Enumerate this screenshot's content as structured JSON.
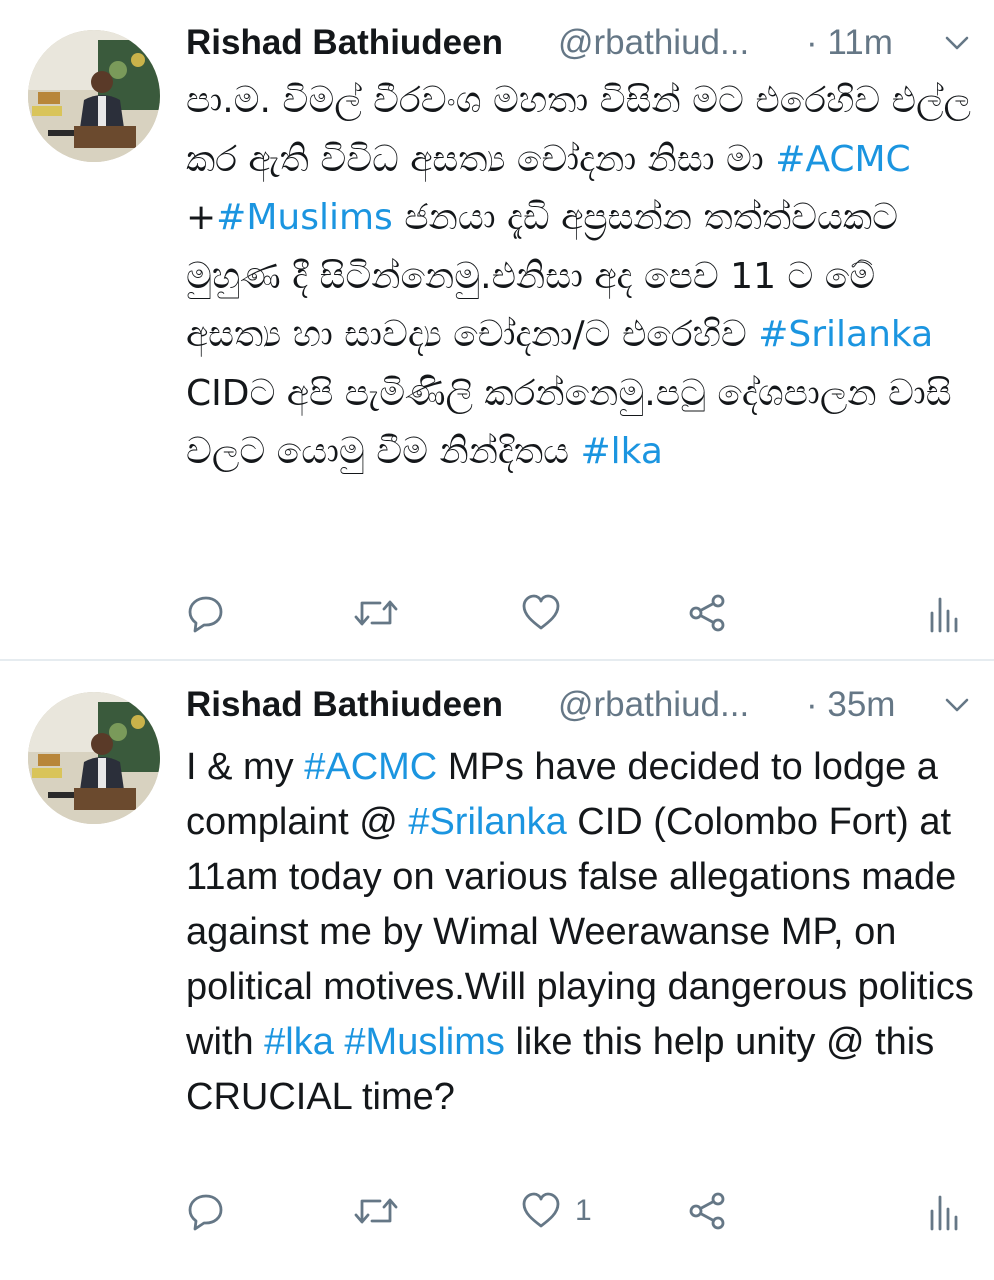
{
  "tweets": [
    {
      "name": "Rishad Bathiudeen",
      "handle": "@rbathiud...",
      "time": "· 11m",
      "segments": [
        {
          "t": "පා.ම. විමල් වීරවංශ මහතා විසින් මට එරෙහිව එල්ල කර ඇති විවිධ අසත්‍ය චෝදනා නිසා මා ",
          "tag": false
        },
        {
          "t": "#ACMC",
          "tag": true
        },
        {
          "t": " +",
          "tag": false
        },
        {
          "t": "#Muslims",
          "tag": true
        },
        {
          "t": " ජනයා දැඩි අප්‍රසන්න තත්ත්වයකට මුහුණ දී සිටින්නෙමු.එනිසා අද පෙව 11 ට මේ අසත්‍ය හා සාවද්‍ය චෝදනා/ට එරෙහිව ",
          "tag": false
        },
        {
          "t": "#Srilanka",
          "tag": true
        },
        {
          "t": " CIDට අපි පැමිණිලි කරන්නෙමු.පටු දේශපාලන වාසි වලට යොමු වීම නින්දිතය ",
          "tag": false
        },
        {
          "t": "#lka",
          "tag": true
        }
      ],
      "actions": {
        "reply_icon": "reply-icon",
        "retweet_icon": "retweet-icon",
        "like_icon": "heart-icon",
        "like_count": "",
        "share_icon": "share-icon",
        "analytics_icon": "analytics-icon"
      }
    },
    {
      "name": "Rishad Bathiudeen",
      "handle": "@rbathiud...",
      "time": "· 35m",
      "segments": [
        {
          "t": "I & my ",
          "tag": false
        },
        {
          "t": "#ACMC",
          "tag": true
        },
        {
          "t": " MPs have decided to lodge a complaint @ ",
          "tag": false
        },
        {
          "t": "#Srilanka",
          "tag": true
        },
        {
          "t": " CID (Colombo Fort) at 11am today on various false allegations made against me by Wimal Weerawanse MP, on political motives.Will playing dangerous politics with ",
          "tag": false
        },
        {
          "t": "#lka",
          "tag": true
        },
        {
          "t": " ",
          "tag": false
        },
        {
          "t": "#Muslims",
          "tag": true
        },
        {
          "t": " like this help unity @ this CRUCIAL time?",
          "tag": false
        }
      ],
      "actions": {
        "reply_icon": "reply-icon",
        "retweet_icon": "retweet-icon",
        "like_icon": "heart-icon",
        "like_count": "1",
        "share_icon": "share-icon",
        "analytics_icon": "analytics-icon"
      }
    }
  ],
  "colors": {
    "link": "#1b95e0",
    "secondary": "#657786",
    "text": "#14171a",
    "divider": "#e6ecf0"
  }
}
